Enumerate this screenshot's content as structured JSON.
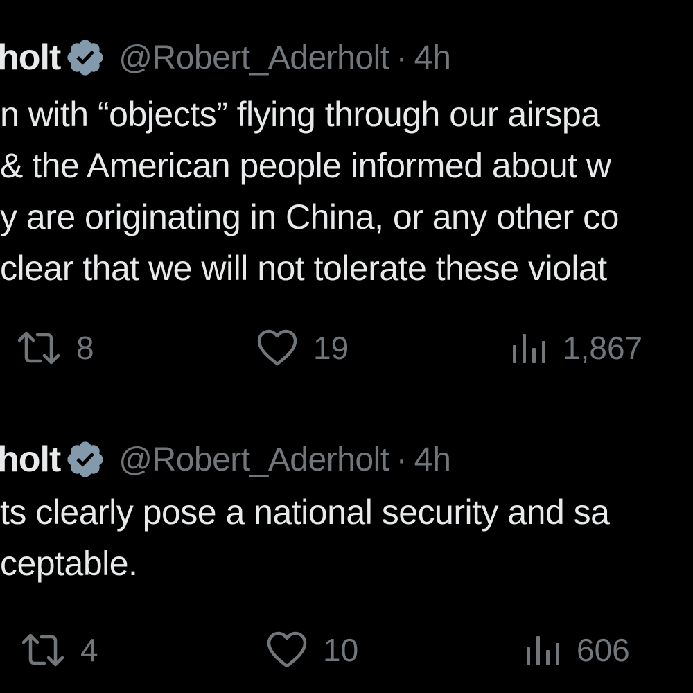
{
  "theme": {
    "background": "#000000",
    "text": "#e7e9ea",
    "muted": "#71767b",
    "verified_badge": "#829aab"
  },
  "tweets": [
    {
      "display_name": "holt",
      "verified_icon": "verified-badge-icon",
      "handle": "@Robert_Aderholt",
      "separator": "·",
      "time": "4h",
      "text_lines": [
        "n with “objects” flying through our airspa",
        "& the American people informed about w",
        "y are originating in China, or any other co",
        "clear that we will not tolerate these violat"
      ],
      "actions": {
        "retweets": "8",
        "likes": "19",
        "views": "1,867"
      }
    },
    {
      "display_name": "holt",
      "verified_icon": "verified-badge-icon",
      "handle": "@Robert_Aderholt",
      "separator": "·",
      "time": "4h",
      "text_lines": [
        "ts clearly pose a national security and sa",
        "ceptable."
      ],
      "actions": {
        "retweets": "4",
        "likes": "10",
        "views": "606"
      }
    }
  ]
}
